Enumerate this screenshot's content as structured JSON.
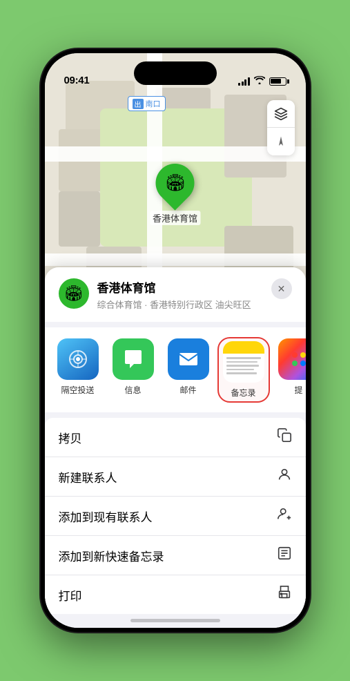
{
  "status_bar": {
    "time": "09:41",
    "location_arrow": "▲"
  },
  "map": {
    "label": "南口",
    "label_prefix": "出",
    "stadium_name": "香港体育馆",
    "controls": {
      "layers": "🗺",
      "location": "➤"
    }
  },
  "location_card": {
    "title": "香港体育馆",
    "subtitle": "综合体育馆 · 香港特别行政区 油尖旺区",
    "close": "✕"
  },
  "share_items": [
    {
      "id": "airdrop",
      "label": "隔空投送"
    },
    {
      "id": "messages",
      "label": "信息"
    },
    {
      "id": "mail",
      "label": "邮件"
    },
    {
      "id": "notes",
      "label": "备忘录"
    },
    {
      "id": "more",
      "label": "提"
    }
  ],
  "actions": [
    {
      "label": "拷贝",
      "icon": "copy"
    },
    {
      "label": "新建联系人",
      "icon": "person"
    },
    {
      "label": "添加到现有联系人",
      "icon": "person-add"
    },
    {
      "label": "添加到新快速备忘录",
      "icon": "memo"
    },
    {
      "label": "打印",
      "icon": "print"
    }
  ]
}
